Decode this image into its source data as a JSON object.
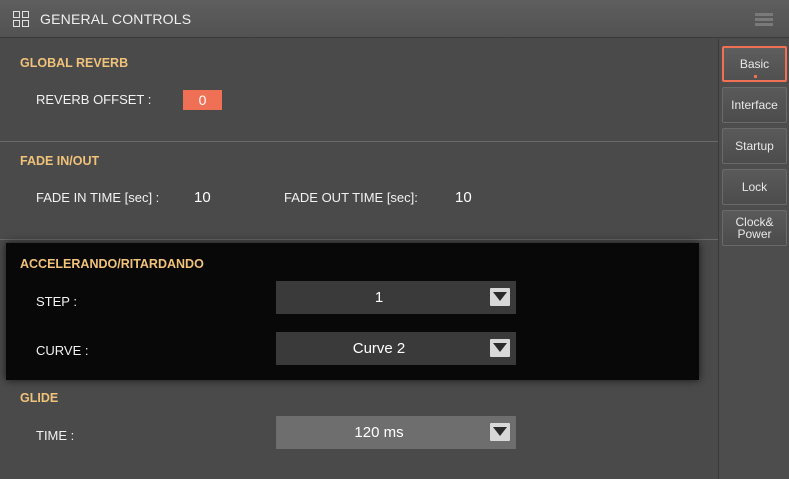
{
  "header": {
    "title": "GENERAL CONTROLS",
    "grid_icon": "grid-icon",
    "menu_icon": "menu-icon"
  },
  "global_reverb": {
    "title": "GLOBAL REVERB",
    "offset_label": "REVERB OFFSET :",
    "offset_value": "0"
  },
  "fade": {
    "title": "FADE IN/OUT",
    "in_label": "FADE IN TIME [sec] :",
    "in_value": "10",
    "out_label": "FADE OUT TIME [sec]:",
    "out_value": "10"
  },
  "accel": {
    "title": "ACCELERANDO/RITARDANDO",
    "step_label": "STEP :",
    "step_value": "1",
    "curve_label": "CURVE :",
    "curve_value": "Curve 2"
  },
  "glide": {
    "title": "GLIDE",
    "time_label": "TIME :",
    "time_value": "120 ms"
  },
  "sidebar": {
    "tabs": [
      {
        "label": "Basic",
        "active": true
      },
      {
        "label": "Interface",
        "active": false
      },
      {
        "label": "Startup",
        "active": false
      },
      {
        "label": "Lock",
        "active": false
      },
      {
        "label": "Clock&\nPower",
        "active": false
      }
    ]
  },
  "colors": {
    "accent": "#f07055",
    "section_title": "#f0c27a"
  }
}
